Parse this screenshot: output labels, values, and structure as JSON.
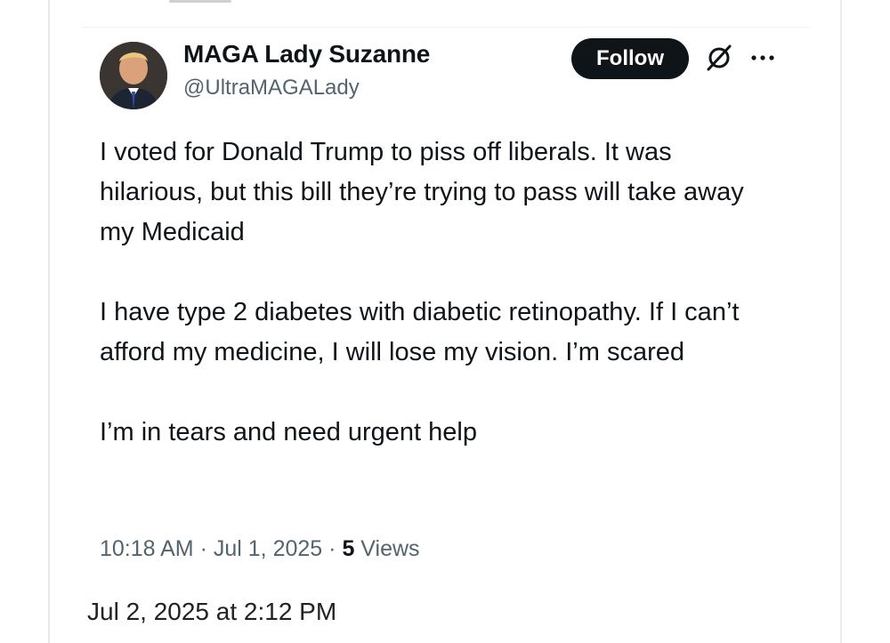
{
  "post": {
    "author": {
      "display_name": "MAGA Lady Suzanne",
      "handle": "@UltraMAGALady"
    },
    "follow_label": "Follow",
    "text": {
      "paragraph_1": "I voted for Donald Trump to piss off liberals. It was hilarious, but this bill they’re trying to pass will take away my Medicaid",
      "paragraph_2": "I have type 2 diabetes with diabetic retinopathy. If I can’t afford my medicine, I will lose my vision. I’m scared",
      "paragraph_3": "I’m in tears and need urgent help"
    },
    "meta": {
      "time": "10:18 AM",
      "separator": "·",
      "date": "Jul 1, 2025",
      "views_count": "5",
      "views_label": "Views"
    }
  },
  "footer": {
    "timestamp": "Jul 2, 2025 at 2:12 PM"
  },
  "icons": {
    "grok": "grok-slash-icon",
    "more": "more-dots-icon"
  },
  "colors": {
    "text_primary": "#0f1419",
    "text_secondary": "#536471",
    "button_bg": "#0f1419",
    "button_text": "#ffffff"
  }
}
